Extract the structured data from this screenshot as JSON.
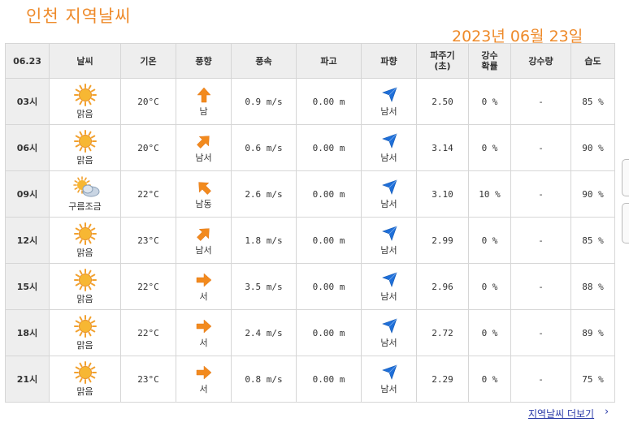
{
  "header": {
    "title": "인천  지역날씨",
    "date": "2023년  06월  23일"
  },
  "table": {
    "headers": [
      "06.23",
      "날씨",
      "기온",
      "풍향",
      "풍속",
      "파고",
      "파향",
      "파주기\n(초)",
      "강수\n확률",
      "강수량",
      "습도"
    ],
    "rows": [
      {
        "time": "03시",
        "weather_icon": "sun-icon",
        "weather": "맑음",
        "temp": "20°C",
        "wind_dir_icon": "arrow-up-icon",
        "wind_dir": "남",
        "wind_speed": "0.9 m/s",
        "wave_height": "0.00 m",
        "wave_dir_icon": "wave-direction-arrow-icon",
        "wave_dir": "남서",
        "wave_period": "2.50",
        "precip_prob": "0 %",
        "precip": "-",
        "humidity": "85 %"
      },
      {
        "time": "06시",
        "weather_icon": "sun-icon",
        "weather": "맑음",
        "temp": "20°C",
        "wind_dir_icon": "arrow-up-right-icon",
        "wind_dir": "남서",
        "wind_speed": "0.6 m/s",
        "wave_height": "0.00 m",
        "wave_dir_icon": "wave-direction-arrow-icon",
        "wave_dir": "남서",
        "wave_period": "3.14",
        "precip_prob": "0 %",
        "precip": "-",
        "humidity": "90 %"
      },
      {
        "time": "09시",
        "weather_icon": "partly-cloudy-icon",
        "weather": "구름조금",
        "temp": "22°C",
        "wind_dir_icon": "arrow-up-left-icon",
        "wind_dir": "남동",
        "wind_speed": "2.6 m/s",
        "wave_height": "0.00 m",
        "wave_dir_icon": "wave-direction-arrow-icon",
        "wave_dir": "남서",
        "wave_period": "3.10",
        "precip_prob": "10 %",
        "precip": "-",
        "humidity": "90 %"
      },
      {
        "time": "12시",
        "weather_icon": "sun-icon",
        "weather": "맑음",
        "temp": "23°C",
        "wind_dir_icon": "arrow-up-right-icon",
        "wind_dir": "남서",
        "wind_speed": "1.8 m/s",
        "wave_height": "0.00 m",
        "wave_dir_icon": "wave-direction-arrow-icon",
        "wave_dir": "남서",
        "wave_period": "2.99",
        "precip_prob": "0 %",
        "precip": "-",
        "humidity": "85 %"
      },
      {
        "time": "15시",
        "weather_icon": "sun-icon",
        "weather": "맑음",
        "temp": "22°C",
        "wind_dir_icon": "arrow-right-icon",
        "wind_dir": "서",
        "wind_speed": "3.5 m/s",
        "wave_height": "0.00 m",
        "wave_dir_icon": "wave-direction-arrow-icon",
        "wave_dir": "남서",
        "wave_period": "2.96",
        "precip_prob": "0 %",
        "precip": "-",
        "humidity": "88 %"
      },
      {
        "time": "18시",
        "weather_icon": "sun-icon",
        "weather": "맑음",
        "temp": "22°C",
        "wind_dir_icon": "arrow-right-icon",
        "wind_dir": "서",
        "wind_speed": "2.4 m/s",
        "wave_height": "0.00 m",
        "wave_dir_icon": "wave-direction-arrow-icon",
        "wave_dir": "남서",
        "wave_period": "2.72",
        "precip_prob": "0 %",
        "precip": "-",
        "humidity": "89 %"
      },
      {
        "time": "21시",
        "weather_icon": "sun-icon",
        "weather": "맑음",
        "temp": "23°C",
        "wind_dir_icon": "arrow-right-icon",
        "wind_dir": "서",
        "wind_speed": "0.8 m/s",
        "wave_height": "0.00 m",
        "wave_dir_icon": "wave-direction-arrow-icon",
        "wave_dir": "남서",
        "wave_period": "2.29",
        "precip_prob": "0 %",
        "precip": "-",
        "humidity": "75 %"
      }
    ]
  },
  "footer": {
    "more_link": "지역날씨 더보기",
    "more_chevron": "›"
  },
  "colors": {
    "accent": "#ee8a2a",
    "wind_arrow": "#f28a1e",
    "wave_arrow": "#1e6fd9",
    "header_bg": "#eeeeee",
    "link": "#2a3aa8"
  }
}
